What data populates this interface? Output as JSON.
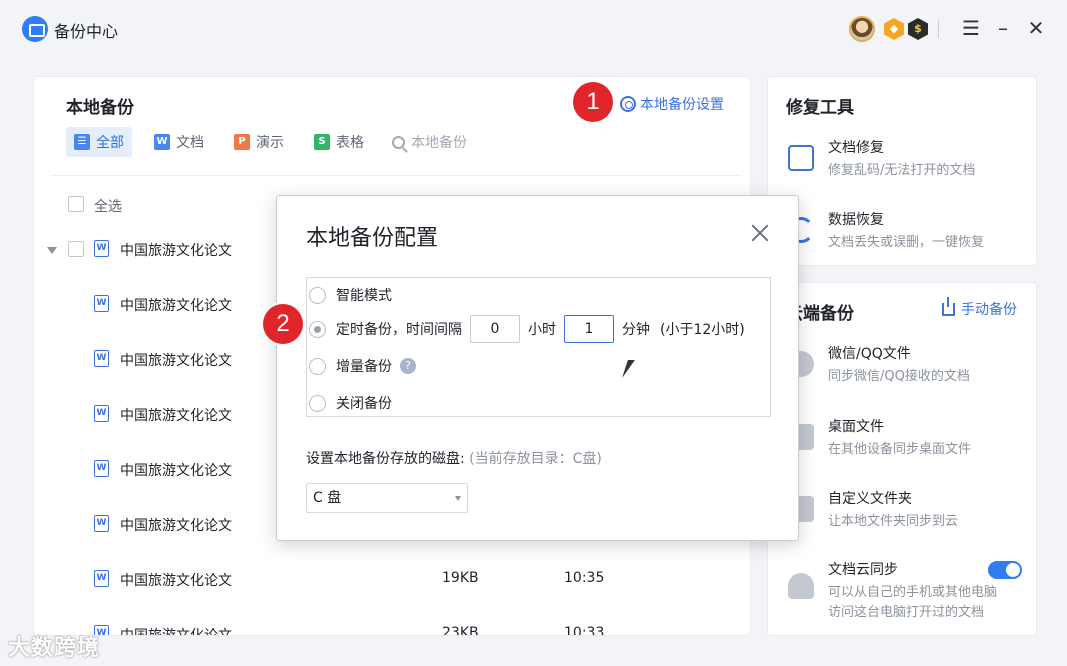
{
  "titlebar": {
    "title": "备份中心"
  },
  "badges": {
    "gold": "◆",
    "dark": "$"
  },
  "left_panel": {
    "title": "本地备份",
    "settings_link": "本地备份设置",
    "tabs": [
      {
        "label": "全部",
        "icon": "☰"
      },
      {
        "label": "文档",
        "icon": "W"
      },
      {
        "label": "演示",
        "icon": "P"
      },
      {
        "label": "表格",
        "icon": "S"
      }
    ],
    "search_placeholder": "本地备份",
    "select_all": "全选",
    "rows": [
      {
        "name": "中国旅游文化论文",
        "size": "",
        "time": ""
      },
      {
        "name": "中国旅游文化论文",
        "size": "",
        "time": ""
      },
      {
        "name": "中国旅游文化论文",
        "size": "",
        "time": ""
      },
      {
        "name": "中国旅游文化论文",
        "size": "",
        "time": ""
      },
      {
        "name": "中国旅游文化论文",
        "size": "",
        "time": ""
      },
      {
        "name": "中国旅游文化论文",
        "size": "",
        "time": ""
      },
      {
        "name": "中国旅游文化论文",
        "size": "19KB",
        "time": "10:35"
      },
      {
        "name": "中国旅游文化论文",
        "size": "23KB",
        "time": "10:33"
      }
    ]
  },
  "repair_tools": {
    "title": "修复工具",
    "items": [
      {
        "name": "文档修复",
        "desc": "修复乱码/无法打开的文档"
      },
      {
        "name": "数据恢复",
        "desc": "文档丢失或误删，一键恢复"
      }
    ]
  },
  "cloud_backup": {
    "title": "云端备份",
    "manual_label": "手动备份",
    "items": [
      {
        "name": "微信/QQ文件",
        "desc": "同步微信/QQ接收的文档"
      },
      {
        "name": "桌面文件",
        "desc": "在其他设备同步桌面文件"
      },
      {
        "name": "自定义文件夹",
        "desc": "让本地文件夹同步到云"
      },
      {
        "name": "文档云同步",
        "desc": "可以从自己的手机或其他电脑",
        "desc2": "访问这台电脑打开过的文档",
        "toggle_on": true
      }
    ]
  },
  "dialog": {
    "title": "本地备份配置",
    "modes": {
      "smart": "智能模式",
      "timed": "定时备份，时间间隔",
      "hours_value": "0",
      "hours_unit": "小时",
      "minutes_value": "1",
      "minutes_unit": "分钟",
      "hint": "(小于12小时)",
      "incremental": "增量备份",
      "help": "?",
      "off": "关闭备份"
    },
    "disk_label": "设置本地备份存放的磁盘:",
    "disk_current": "(当前存放目录：C盘)",
    "disk_selected": "C 盘"
  },
  "markers": {
    "one": "1",
    "two": "2"
  },
  "watermark": "大数跨境",
  "colors": {
    "accent": "#2f7cf6",
    "marker": "#e1262b"
  }
}
